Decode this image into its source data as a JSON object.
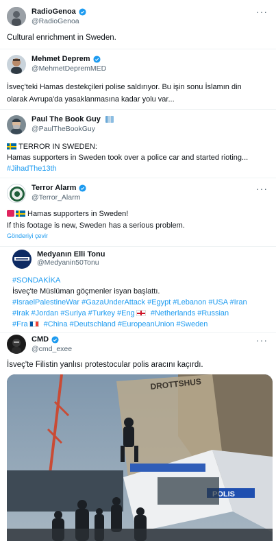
{
  "tweets": [
    {
      "display_name": "RadioGenoa",
      "handle": "@RadioGenoa",
      "text": "Cultural enrichment in Sweden."
    },
    {
      "display_name": "Mehmet Deprem",
      "handle": "@MehmetDepremMED",
      "text_line1": "İsveç'teki Hamas destekçileri polise saldırıyor. Bu işin sonu İslamın din",
      "text_line2": "olarak Avrupa'da yasaklanmasına kadar yolu var..."
    },
    {
      "display_name": "Paul The Book Guy",
      "handle": "@PaulTheBookGuy",
      "text_line1": "TERROR IN SWEDEN:",
      "text_line2": "Hamas supporters in Sweden took over a police car and started rioting...",
      "hashtag": "#JihadThe13th"
    },
    {
      "display_name": "Terror Alarm",
      "handle": "@Terror_Alarm",
      "text_line1": "Hamas supporters in Sweden!",
      "text_line2": "If this footage is new, Sweden has a serious problem.",
      "translate": "Gönderiyi çevir"
    },
    {
      "display_name": "Medyanın Elli Tonu",
      "handle": "@Medyanin50Tonu",
      "breaking_tag": "#SONDAKİKA",
      "text_line1": "İsveç'te Müslüman göçmenler isyan başlattı.",
      "tags_line1": "#IsraelPalestineWar #GazaUnderAttack #Egypt #Lebanon #USA #Iran",
      "tags_line2a": "#Irak #Jordan #Suriya #Turkey #Eng",
      "tags_line2b": "#Netherlands #Russian",
      "tags_line3a": "#Fra",
      "tags_line3b": "#China #Deutschland #EuropeanUnion #Sweden"
    },
    {
      "display_name": "CMD",
      "handle": "@cmd_exee",
      "text": "İsveç'te Filistin yanlısı protestocular polis aracını kaçırdı."
    }
  ],
  "video": {
    "building_sign": "DROTTSHUS",
    "vehicle_label": "POLIS"
  },
  "more_icon_glyph": "···",
  "colors": {
    "verified": "#1d9bf0",
    "link": "#1d9bf0",
    "secondary_text": "#536471"
  }
}
